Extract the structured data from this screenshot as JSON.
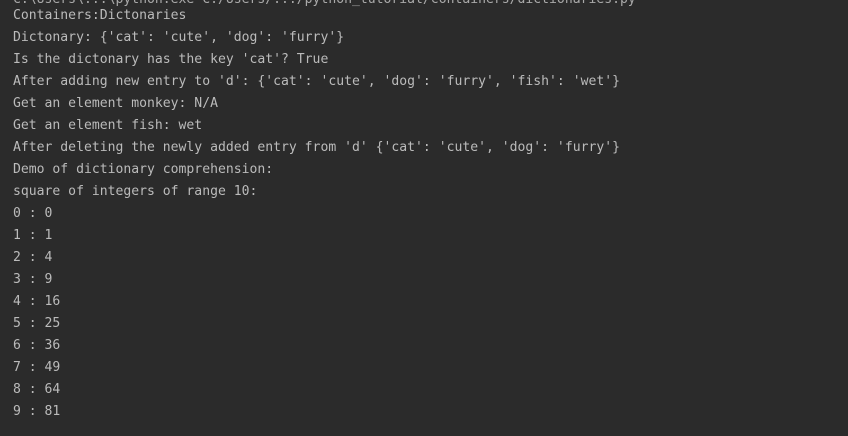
{
  "console": {
    "cut_top_line": "C:\\Users\\...\\python.exe C:/Users/.../python_tutorial/containers/dictionaries.py",
    "lines": [
      "Containers:Dictonaries",
      "Dictonary: {'cat': 'cute', 'dog': 'furry'}",
      "Is the dictonary has the key 'cat'? True",
      "After adding new entry to 'd': {'cat': 'cute', 'dog': 'furry', 'fish': 'wet'}",
      "Get an element monkey: N/A",
      "Get an element fish: wet",
      "After deleting the newly added entry from 'd' {'cat': 'cute', 'dog': 'furry'}",
      "Demo of dictionary comprehension:",
      "square of integers of range 10:",
      "0 : 0",
      "1 : 1",
      "2 : 4",
      "3 : 9",
      "4 : 16",
      "5 : 25",
      "6 : 36",
      "7 : 49",
      "8 : 64",
      "9 : 81"
    ]
  }
}
